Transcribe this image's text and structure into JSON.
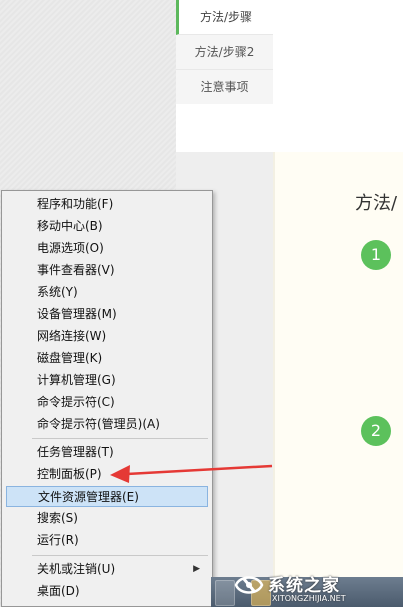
{
  "tabs": [
    {
      "label": "方法/步骤",
      "active": true
    },
    {
      "label": "方法/步骤2",
      "active": false
    },
    {
      "label": "注意事项",
      "active": false
    }
  ],
  "content": {
    "title": "方法/",
    "steps": [
      "1",
      "2"
    ]
  },
  "menu": {
    "items": [
      {
        "label": "程序和功能(F)"
      },
      {
        "label": "移动中心(B)"
      },
      {
        "label": "电源选项(O)"
      },
      {
        "label": "事件查看器(V)"
      },
      {
        "label": "系统(Y)"
      },
      {
        "label": "设备管理器(M)"
      },
      {
        "label": "网络连接(W)"
      },
      {
        "label": "磁盘管理(K)"
      },
      {
        "label": "计算机管理(G)"
      },
      {
        "label": "命令提示符(C)"
      },
      {
        "label": "命令提示符(管理员)(A)"
      },
      {
        "label": "任务管理器(T)"
      },
      {
        "label": "控制面板(P)"
      },
      {
        "label": "文件资源管理器(E)",
        "highlighted": true
      },
      {
        "label": "搜索(S)"
      },
      {
        "label": "运行(R)"
      },
      {
        "label": "关机或注销(U)",
        "has_submenu": true
      },
      {
        "label": "桌面(D)"
      }
    ]
  },
  "watermark": {
    "brand": "系统之家",
    "url": "XITONGZHIJIA.NET"
  },
  "colors": {
    "step_badge": "#5cc15c",
    "arrow": "#e53935",
    "menu_highlight": "#cde3f7",
    "tab_accent": "#5cb85c"
  }
}
